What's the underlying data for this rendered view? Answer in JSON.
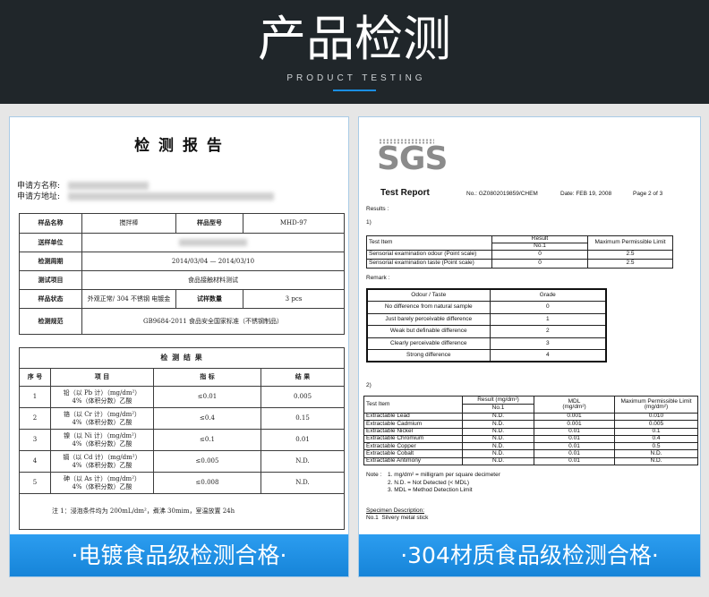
{
  "header": {
    "title": "产品检测",
    "subtitle": "PRODUCT TESTING"
  },
  "left_report": {
    "title": "检 测 报 告",
    "applicant_name_label": "申请方名称:",
    "applicant_address_label": "申请方地址:",
    "info": {
      "sample_name_label": "样品名称",
      "sample_name": "搅拌棒",
      "sample_model_label": "样品型号",
      "sample_model": "MHD-97",
      "sender_label": "送样单位",
      "period_label": "检测周期",
      "period": "2014/03/04 — 2014/03/10",
      "test_item_label": "测试项目",
      "test_item": "食品接触材料测试",
      "state_label": "样品状态",
      "state": "外观正常/ 304 不锈钢 电镀金",
      "quantity_label": "试样数量",
      "quantity": "3 pcs",
      "standard_label": "检测规范",
      "standard": "GB9684-2011 食品安全国家标准（不锈钢制品）"
    },
    "results": {
      "title": "检 测 结 果",
      "columns": [
        "序 号",
        "项 目",
        "指 标",
        "结 果"
      ],
      "rows": [
        {
          "no": "1",
          "item": "铅（以 Pb 计）（mg/dm²）",
          "medium": "4%（体积分数）乙酸",
          "limit": "≤0.01",
          "result": "0.005"
        },
        {
          "no": "2",
          "item": "铬（以 Cr 计）（mg/dm²）",
          "medium": "4%（体积分数）乙酸",
          "limit": "≤0.4",
          "result": "0.15"
        },
        {
          "no": "3",
          "item": "镍（以 Ni 计）（mg/dm²）",
          "medium": "4%（体积分数）乙酸",
          "limit": "≤0.1",
          "result": "0.01"
        },
        {
          "no": "4",
          "item": "镉（以 Cd 计）（mg/dm²）",
          "medium": "4%（体积分数）乙酸",
          "limit": "≤0.005",
          "result": "N.D."
        },
        {
          "no": "5",
          "item": "砷（以 As 计）（mg/dm²）",
          "medium": "4%（体积分数）乙酸",
          "limit": "≤0.008",
          "result": "N.D."
        }
      ],
      "note": "注 1：浸泡条件均为 200mL/dm²，煮沸 30mim，室温放置 24h"
    },
    "banner": "·电镀食品级检测合格·"
  },
  "right_report": {
    "logo": "SGS",
    "title": "Test Report",
    "report_no": "No.: GZ0802019859/CHEM",
    "date": "Date: FEB 19, 2008",
    "page": "Page 2 of 3",
    "results_label": "Results :",
    "section1_label": "1)",
    "sensory_table": {
      "col_item": "Test Item",
      "col_result": "Result",
      "col_sample": "No.1",
      "col_limit": "Maximum Permissible Limit",
      "rows": [
        {
          "item": "Sensorial examination odour (Point scale)",
          "result": "0",
          "limit": "2.5"
        },
        {
          "item": "Sensorial examination taste (Point scale)",
          "result": "0",
          "limit": "2.5"
        }
      ]
    },
    "remark_label": "Remark :",
    "grade_table": {
      "col_odour": "Odour / Taste",
      "col_grade": "Grade",
      "rows": [
        {
          "desc": "No difference from natural sample",
          "grade": "0"
        },
        {
          "desc": "Just barely perceivable difference",
          "grade": "1"
        },
        {
          "desc": "Weak but definable difference",
          "grade": "2"
        },
        {
          "desc": "Clearly perceivable difference",
          "grade": "3"
        },
        {
          "desc": "Strong difference",
          "grade": "4"
        }
      ]
    },
    "section2_label": "2)",
    "metal_table": {
      "col_item": "Test Item",
      "col_result": "Result (mg/dm²)",
      "col_sample": "No.1",
      "col_mdl": "MDL",
      "col_mdl_unit": "(mg/dm²)",
      "col_limit": "Maximum Permissible Limit",
      "col_limit_unit": "(mg/dm²)",
      "rows": [
        {
          "item": "Extractable Lead",
          "result": "N.D.",
          "mdl": "0.001",
          "limit": "0.010"
        },
        {
          "item": "Extractable Cadmium",
          "result": "N.D.",
          "mdl": "0.001",
          "limit": "0.005"
        },
        {
          "item": "Extractable Nickel",
          "result": "N.D.",
          "mdl": "0.01",
          "limit": "0.1"
        },
        {
          "item": "Extractable Chromium",
          "result": "N.D.",
          "mdl": "0.01",
          "limit": "0.4"
        },
        {
          "item": "Extractable Copper",
          "result": "N.D.",
          "mdl": "0.01",
          "limit": "0.5"
        },
        {
          "item": "Extractable Cobalt",
          "result": "N.D.",
          "mdl": "0.01",
          "limit": "N.D."
        },
        {
          "item": "Extractable Antimony",
          "result": "N.D.",
          "mdl": "0.01",
          "limit": "N.D."
        }
      ]
    },
    "note_label": "Note :",
    "notes": [
      "1. mg/dm² = milligram per square decimeter",
      "2. N.D. = Not Detected (< MDL)",
      "3. MDL = Method Detection Limit"
    ],
    "specimen_label": "Specimen Description:",
    "specimen": "No.1  Silvery metal stick",
    "banner": "·304材质食品级检测合格·"
  },
  "colors": {
    "header_bg": "#20262a",
    "accent_blue": "#1a8ee3",
    "page_bg": "#e6e6e6"
  }
}
